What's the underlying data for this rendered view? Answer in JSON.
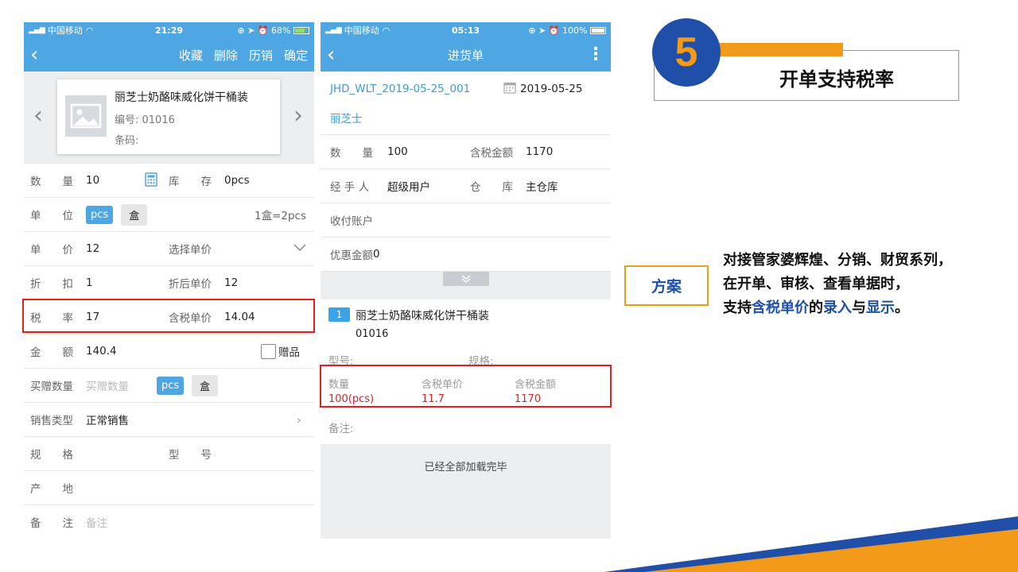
{
  "left_phone": {
    "status": {
      "carrier": "中国移动",
      "time": "21:29",
      "battery": "68%"
    },
    "nav": {
      "actions": [
        "收藏",
        "删除",
        "历销",
        "确定"
      ]
    },
    "product": {
      "name": "丽芝士奶酪味威化饼干桶装",
      "code": "编号: 01016",
      "barcode": "条码:"
    },
    "rows": {
      "qty_label": "数　　量",
      "qty_value": "10",
      "stock_label": "库　　存",
      "stock_value": "0pcs",
      "unit_label": "单　　位",
      "unit_pcs": "pcs",
      "unit_box": "盒",
      "unit_ratio": "1盒=2pcs",
      "price_label": "单　　价",
      "price_value": "12",
      "price_select": "选择单价",
      "discount_label": "折　　扣",
      "discount_value": "1",
      "after_discount_label": "折后单价",
      "after_discount_value": "12",
      "tax_label": "税　　率",
      "tax_value": "17",
      "tax_price_label": "含税单价",
      "tax_price_value": "14.04",
      "amount_label": "金　　额",
      "amount_value": "140.4",
      "gift_label": "赠品",
      "gift_qty_label": "买赠数量",
      "gift_qty_placeholder": "买赠数量",
      "gift_pcs": "pcs",
      "gift_box": "盒",
      "sale_type_label": "销售类型",
      "sale_type_value": "正常销售",
      "spec_label": "规　　格",
      "model_label": "型　　号",
      "origin_label": "产　　地",
      "note_label": "备　　注",
      "note_placeholder": "备注"
    }
  },
  "right_phone": {
    "status": {
      "carrier": "中国移动",
      "time": "05:13",
      "battery": "100%"
    },
    "nav": {
      "title": "进货单"
    },
    "order_no": "JHD_WLT_2019-05-25_001",
    "date": "2019-05-25",
    "supplier": "丽芝士",
    "qty_label": "数　　量",
    "qty_value": "100",
    "tax_amount_label": "含税金额",
    "tax_amount_value": "1170",
    "handler_label": "经 手 人",
    "handler_value": "超级用户",
    "warehouse_label": "仓　　库",
    "warehouse_value": "主仓库",
    "account_label": "收付账户",
    "discount_label": "优惠金额",
    "discount_value": "0",
    "item": {
      "index": "1",
      "name": "丽芝士奶酪味威化饼干桶装",
      "code": "01016",
      "model_label": "型号:",
      "spec_label": "规格:",
      "qty_header": "数量",
      "price_header": "含税单价",
      "amount_header": "含税金额",
      "qty_value": "100(pcs)",
      "price_value": "11.7",
      "amount_value": "1170",
      "note_label": "备注:"
    },
    "footer_text": "已经全部加载完毕"
  },
  "slide": {
    "step_number": "5",
    "step_title": "开单支持税率",
    "plan_label": "方案",
    "desc_line1": "对接管家婆辉煌、分销、财贸系列，",
    "desc_line2": "在开单、审核、查看单据时，",
    "desc_line3_prefix": "支持",
    "desc_line3_em1": "含税单价",
    "desc_line3_mid1": "的",
    "desc_line3_em2": "录入",
    "desc_line3_mid2": "与",
    "desc_line3_em3": "显示",
    "desc_line3_suffix": "。",
    "colors": {
      "blue": "#1f4fa8",
      "orange": "#f39a1a",
      "red": "#e02020",
      "app_blue": "#4ea6e3"
    }
  }
}
